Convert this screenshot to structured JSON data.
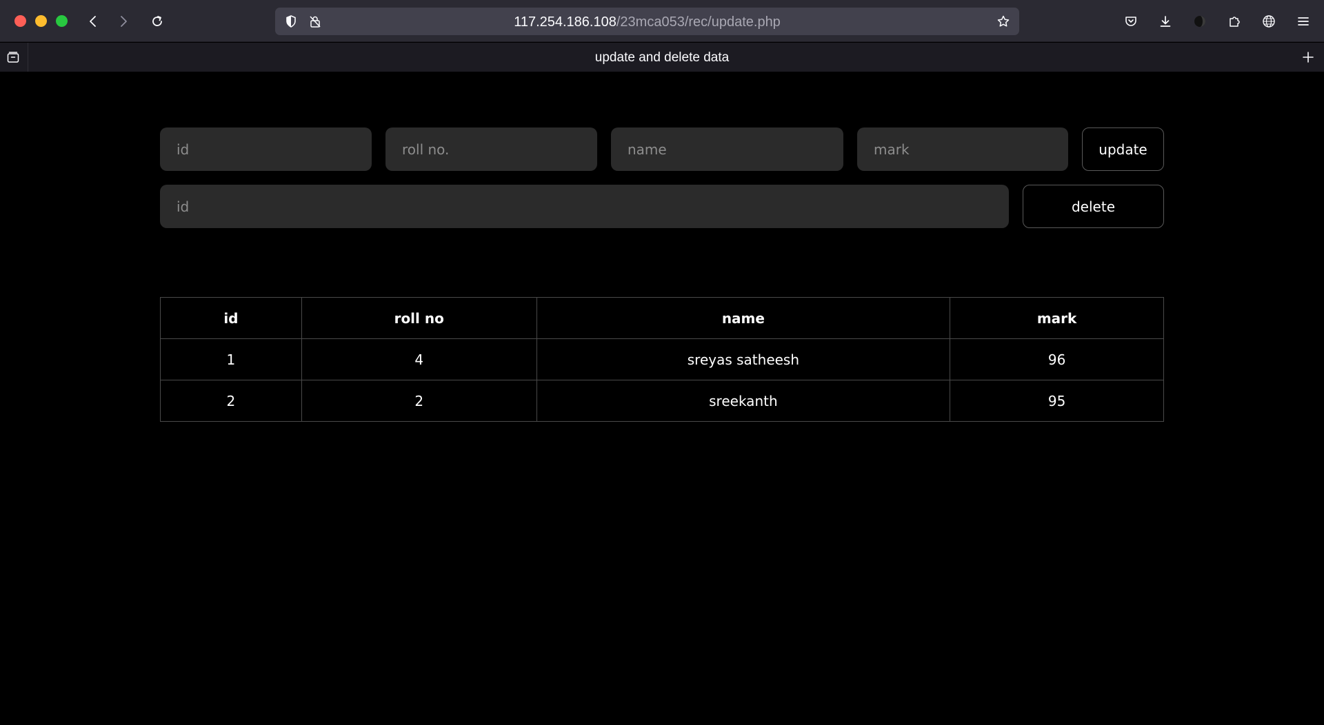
{
  "browser": {
    "url_host": "117.254.186.108",
    "url_path": "/23mca053/rec/update.php",
    "tab_title": "update and delete data"
  },
  "update_form": {
    "id_placeholder": "id",
    "roll_placeholder": "roll no.",
    "name_placeholder": "name",
    "mark_placeholder": "mark",
    "button_label": "update"
  },
  "delete_form": {
    "id_placeholder": "id",
    "button_label": "delete"
  },
  "table": {
    "headers": [
      "id",
      "roll no",
      "name",
      "mark"
    ],
    "rows": [
      [
        "1",
        "4",
        "sreyas satheesh",
        "96"
      ],
      [
        "2",
        "2",
        "sreekanth",
        "95"
      ]
    ]
  }
}
